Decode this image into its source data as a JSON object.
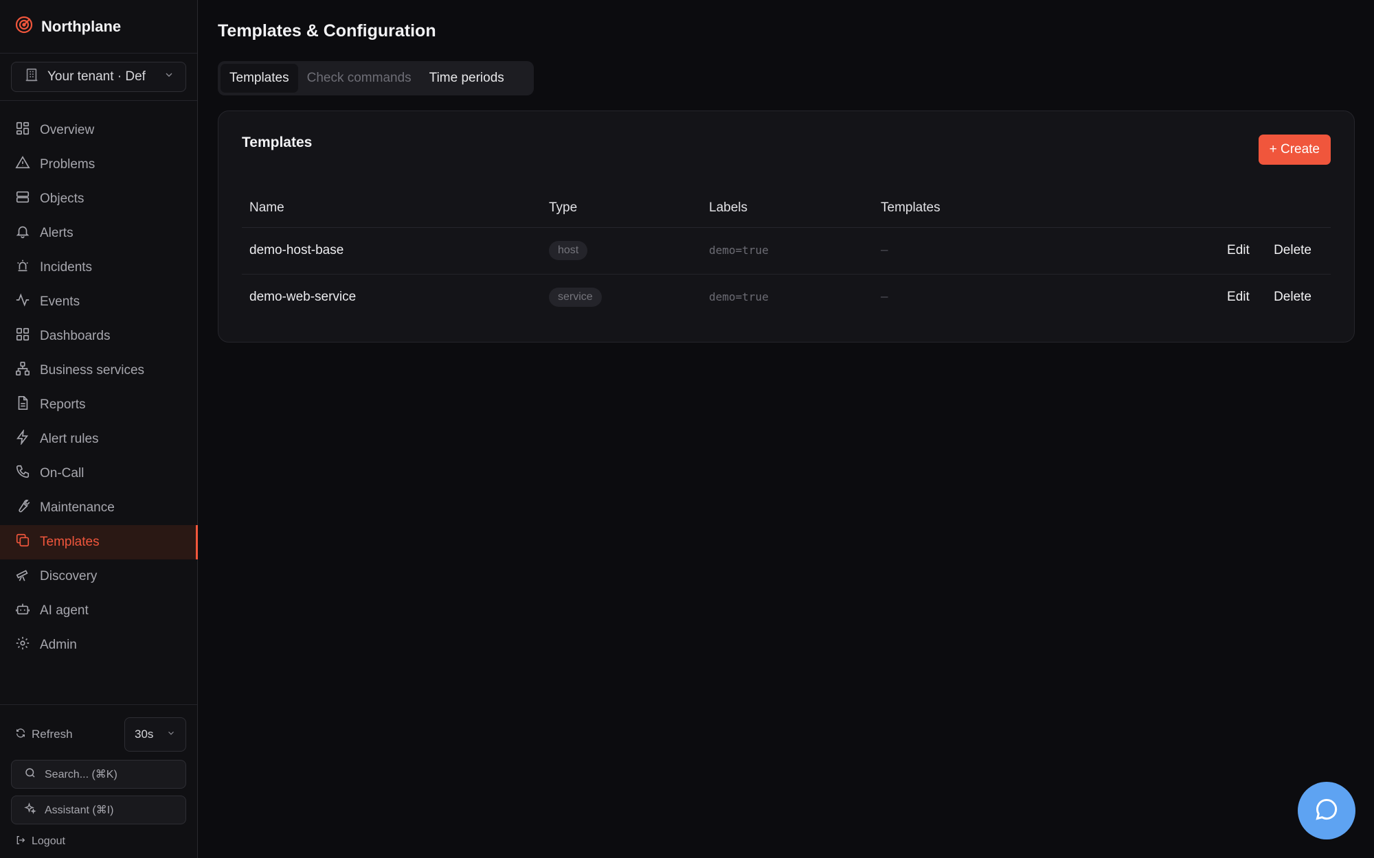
{
  "brand": {
    "name": "Northplane"
  },
  "tenant": {
    "label": "Your tenant · Def"
  },
  "nav": [
    {
      "label": "Overview",
      "icon": "grid-icon"
    },
    {
      "label": "Problems",
      "icon": "warning-icon"
    },
    {
      "label": "Objects",
      "icon": "server-icon"
    },
    {
      "label": "Alerts",
      "icon": "bell-icon"
    },
    {
      "label": "Incidents",
      "icon": "siren-icon"
    },
    {
      "label": "Events",
      "icon": "activity-icon"
    },
    {
      "label": "Dashboards",
      "icon": "dashboard-icon"
    },
    {
      "label": "Business services",
      "icon": "network-icon"
    },
    {
      "label": "Reports",
      "icon": "document-icon"
    },
    {
      "label": "Alert rules",
      "icon": "lightning-icon"
    },
    {
      "label": "On-Call",
      "icon": "phone-icon"
    },
    {
      "label": "Maintenance",
      "icon": "wrench-icon"
    },
    {
      "label": "Templates",
      "icon": "copy-icon",
      "active": true
    },
    {
      "label": "Discovery",
      "icon": "telescope-icon"
    },
    {
      "label": "AI agent",
      "icon": "robot-icon"
    },
    {
      "label": "Admin",
      "icon": "gear-icon"
    }
  ],
  "footer": {
    "refresh_label": "Refresh",
    "interval": "30s",
    "search_label": "Search... (⌘K)",
    "assistant_label": "Assistant (⌘I)",
    "logout_label": "Logout"
  },
  "page": {
    "title": "Templates & Configuration"
  },
  "tabs": [
    {
      "label": "Templates",
      "state": "active"
    },
    {
      "label": "Check commands",
      "state": "muted"
    },
    {
      "label": "Time periods",
      "state": "normal"
    }
  ],
  "card": {
    "title": "Templates",
    "create_label": "+ Create",
    "columns": [
      "Name",
      "Type",
      "Labels",
      "Templates"
    ],
    "rows": [
      {
        "name": "demo-host-base",
        "type": "host",
        "labels": "demo=true",
        "templates": "–",
        "edit": "Edit",
        "delete": "Delete"
      },
      {
        "name": "demo-web-service",
        "type": "service",
        "labels": "demo=true",
        "templates": "–",
        "edit": "Edit",
        "delete": "Delete"
      }
    ]
  },
  "colors": {
    "accent": "#f0563c",
    "fab": "#5ea3f2",
    "background": "#0c0c0f"
  }
}
